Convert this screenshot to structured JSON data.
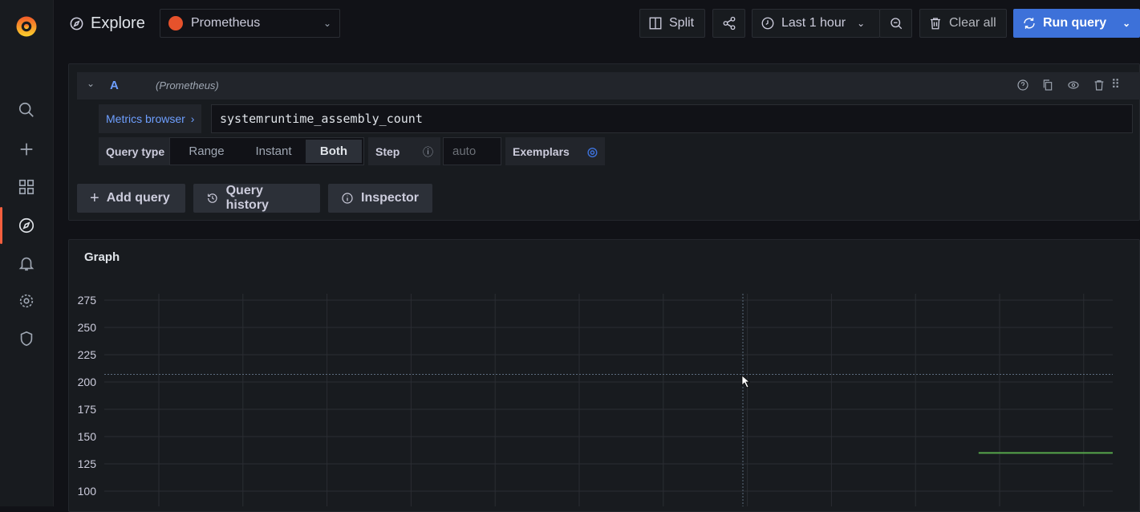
{
  "sidebar": {
    "items": [
      "search",
      "create",
      "dashboards",
      "explore",
      "alerting",
      "configuration",
      "server-admin"
    ],
    "active": "explore"
  },
  "header": {
    "title": "Explore",
    "datasource": "Prometheus",
    "split_label": "Split",
    "time_range": "Last 1 hour",
    "clear_label": "Clear all",
    "run_label": "Run query"
  },
  "query": {
    "ref_id": "A",
    "datasource_hint": "(Prometheus)",
    "metrics_browser_label": "Metrics browser",
    "expression": "systemruntime_assembly_count",
    "query_type_label": "Query type",
    "query_types": [
      "Range",
      "Instant",
      "Both"
    ],
    "selected_query_type": "Both",
    "step_label": "Step",
    "step_placeholder": "auto",
    "exemplars_label": "Exemplars"
  },
  "actions": {
    "add_query": "Add query",
    "query_history": "Query history",
    "inspector": "Inspector"
  },
  "graph": {
    "title": "Graph"
  },
  "colors": {
    "accent": "#3d71d9",
    "series": "#56a64b",
    "grafana": "#f55f3e"
  },
  "chart_data": {
    "type": "line",
    "title": "Graph",
    "ylabel": "",
    "xlabel": "",
    "yticks": [
      "275",
      "250",
      "225",
      "200",
      "175",
      "150",
      "125",
      "100"
    ],
    "ylim": [
      100,
      275
    ],
    "series": [
      {
        "name": "systemruntime_assembly_count",
        "x_range_fraction": [
          0.867,
          1.0
        ],
        "value": 135
      }
    ],
    "grid": true
  }
}
